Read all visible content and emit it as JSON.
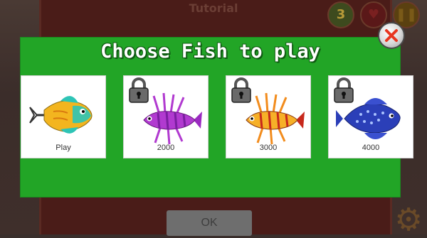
{
  "background": {
    "title": "Tutorial",
    "lives": "3",
    "ok_label": "OK"
  },
  "popup": {
    "title": "Choose Fish to play",
    "close_icon": "close-x-icon",
    "accent_color": "#22a526",
    "cards": [
      {
        "label": "Play",
        "locked": false,
        "fish": "yellow-teal-triggerfish",
        "primary": "#f3b51f",
        "secondary": "#2ec4b6"
      },
      {
        "label": "2000",
        "locked": true,
        "fish": "purple-lionfish",
        "primary": "#b13ad0",
        "secondary": "#7a1fa0"
      },
      {
        "label": "3000",
        "locked": true,
        "fish": "orange-lionfish",
        "primary": "#f28c1d",
        "secondary": "#c7281b"
      },
      {
        "label": "4000",
        "locked": true,
        "fish": "blue-spotted-fish",
        "primary": "#2b3fb8",
        "secondary": "#6a8ef0"
      }
    ]
  }
}
